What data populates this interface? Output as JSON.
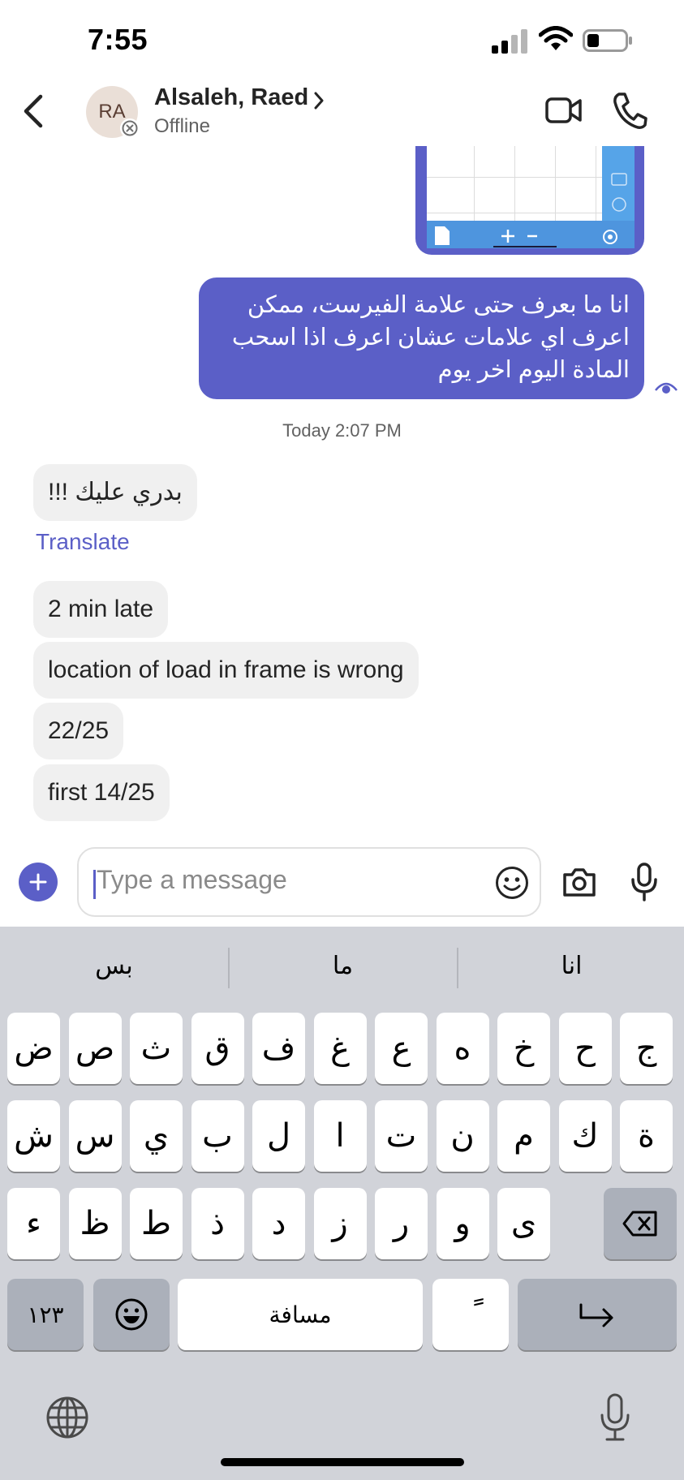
{
  "status_bar": {
    "time": "7:55"
  },
  "header": {
    "avatar_initials": "RA",
    "contact_name": "Alsaleh, Raed",
    "contact_status": "Offline"
  },
  "messages": {
    "outgoing_text": "انا ما بعرف حتى علامة الفيرست، ممكن اعرف اي علامات عشان اعرف اذا اسحب المادة اليوم اخر يوم",
    "timestamp": "Today 2:07 PM",
    "incoming": [
      {
        "text": "بدري عليك !!!"
      },
      {
        "text": "2 min late"
      },
      {
        "text": "location of load in frame is wrong"
      },
      {
        "text": "22/25"
      },
      {
        "text": "first 14/25"
      }
    ],
    "translate_label": "Translate"
  },
  "compose": {
    "placeholder": "Type a message"
  },
  "keyboard": {
    "suggestions": [
      "بس",
      "ما",
      "انا"
    ],
    "row1": [
      "ض",
      "ص",
      "ث",
      "ق",
      "ف",
      "غ",
      "ع",
      "ه",
      "خ",
      "ح",
      "ج"
    ],
    "row2": [
      "ش",
      "س",
      "ي",
      "ب",
      "ل",
      "ا",
      "ت",
      "ن",
      "م",
      "ك",
      "ة"
    ],
    "row3": [
      "ء",
      "ظ",
      "ط",
      "ذ",
      "د",
      "ز",
      "ر",
      "و",
      "ى"
    ],
    "numbers_key": "١٢٣",
    "space_key": "مسافة",
    "diacritic_key": "ً"
  },
  "colors": {
    "accent": "#5b5fc7",
    "bubble_in": "#f0f0f0",
    "keyboard_bg": "#d1d3d9"
  }
}
